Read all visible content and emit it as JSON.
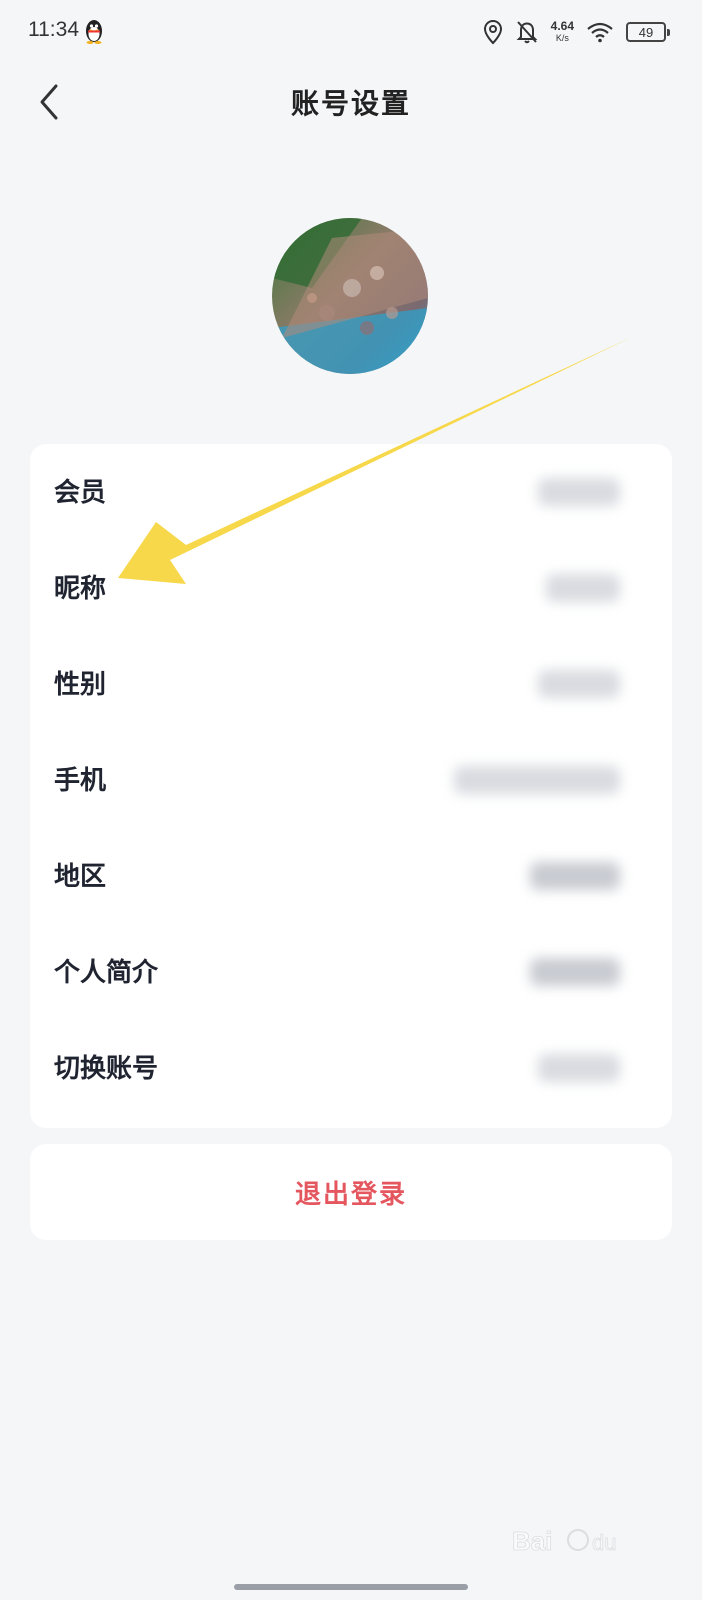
{
  "status_bar": {
    "time": "11:34",
    "net_speed_value": "4.64",
    "net_speed_unit": "K/s",
    "battery_level": "49",
    "icons": [
      "qq-penguin-icon",
      "location-icon",
      "bell-muted-icon",
      "wifi-icon",
      "battery-icon"
    ]
  },
  "header": {
    "title": "账号设置",
    "back_icon": "chevron-left-icon"
  },
  "settings": {
    "items": [
      {
        "label": "会员"
      },
      {
        "label": "昵称"
      },
      {
        "label": "性别"
      },
      {
        "label": "手机"
      },
      {
        "label": "地区"
      },
      {
        "label": "个人简介"
      },
      {
        "label": "切换账号"
      }
    ]
  },
  "logout": {
    "label": "退出登录"
  },
  "colors": {
    "background": "#f5f6f8",
    "card": "#ffffff",
    "logout_text": "#e5575f",
    "annotation_arrow": "#f7d84a"
  }
}
